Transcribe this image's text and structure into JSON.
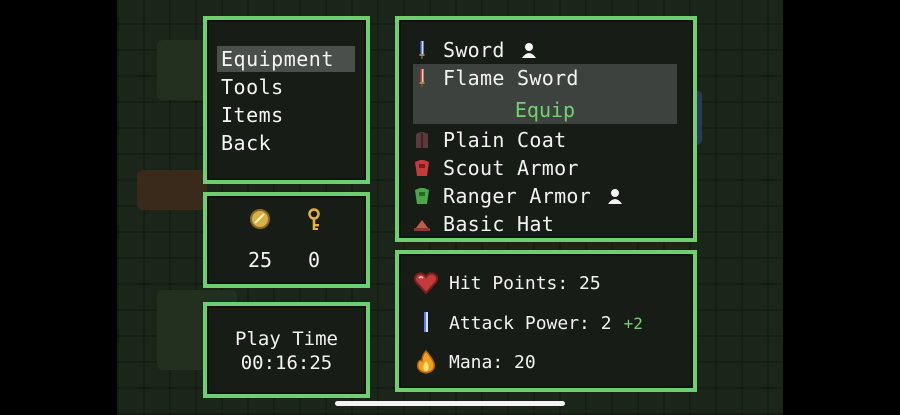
{
  "menu": {
    "items": [
      {
        "label": "Equipment",
        "selected": true
      },
      {
        "label": "Tools",
        "selected": false
      },
      {
        "label": "Items",
        "selected": false
      },
      {
        "label": "Back",
        "selected": false
      }
    ]
  },
  "currency": {
    "coins": {
      "icon": "coin-icon",
      "value": "25"
    },
    "keys": {
      "icon": "key-icon",
      "value": "0"
    }
  },
  "play_time": {
    "label": "Play Time",
    "value": "00:16:25"
  },
  "equipment_list": {
    "items": [
      {
        "name": "Sword",
        "icon": "sword-icon",
        "equipped": true
      },
      {
        "name": "Flame Sword",
        "icon": "flame-sword-icon",
        "equipped": false,
        "selected": true
      },
      {
        "name": "Plain Coat",
        "icon": "coat-icon",
        "equipped": false
      },
      {
        "name": "Scout Armor",
        "icon": "scout-armor-icon",
        "equipped": false
      },
      {
        "name": "Ranger Armor",
        "icon": "ranger-armor-icon",
        "equipped": true
      },
      {
        "name": "Basic Hat",
        "icon": "hat-icon",
        "equipped": false
      }
    ],
    "equip_action": "Equip"
  },
  "stats": {
    "hit_points": {
      "label": "Hit Points: 25",
      "icon": "heart-icon"
    },
    "attack_power": {
      "label": "Attack Power: 2",
      "bonus": "+2",
      "icon": "sword-icon"
    },
    "mana": {
      "label": "Mana: 20",
      "icon": "flame-icon"
    }
  },
  "colors": {
    "panel_border": "#6fce72",
    "panel_bg": "#171c16",
    "highlight": "#6fd36f"
  }
}
